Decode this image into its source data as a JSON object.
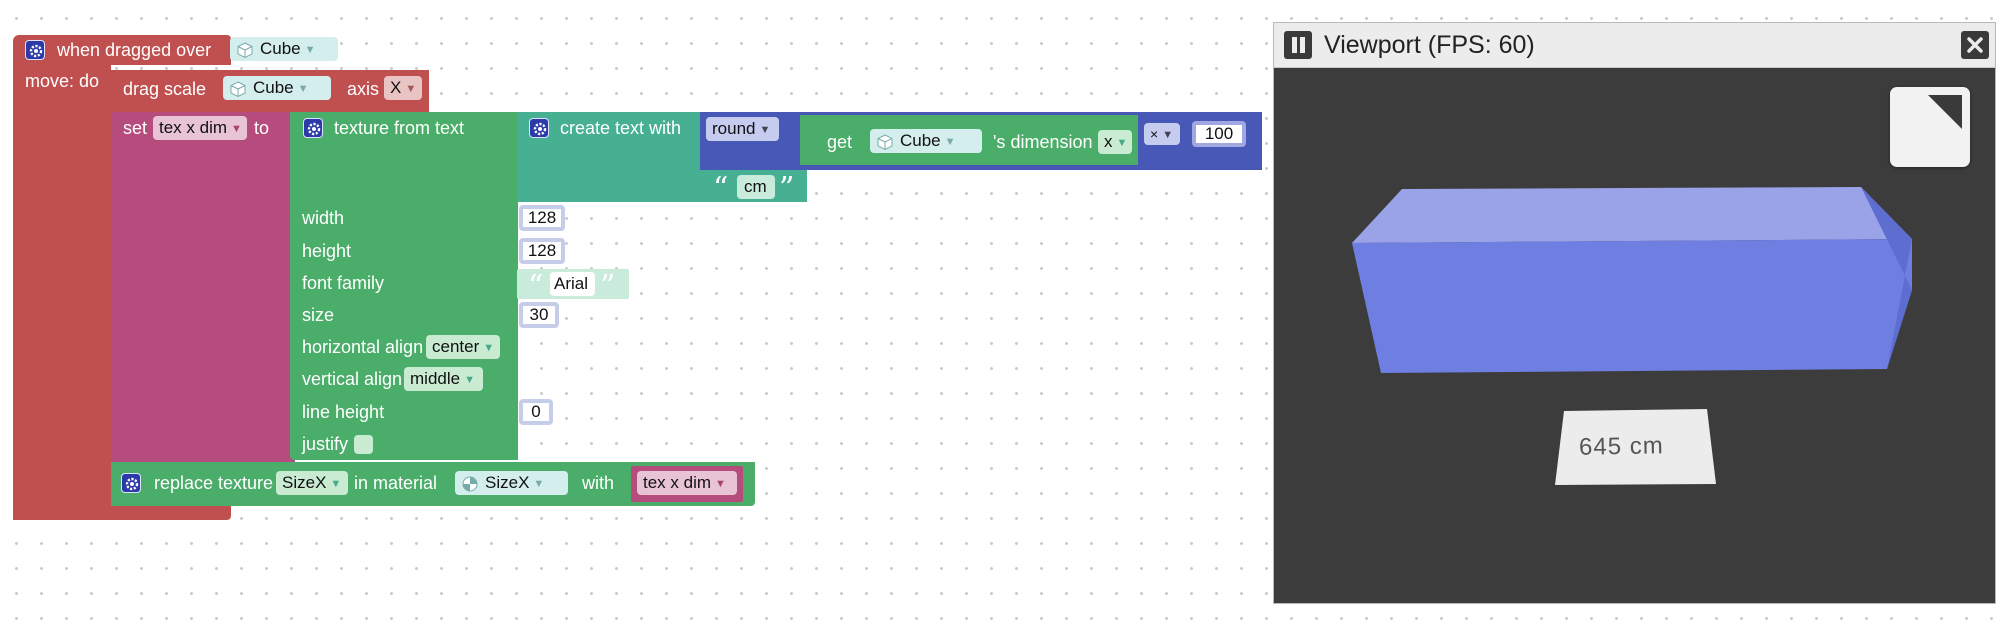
{
  "blocks": {
    "event": {
      "label": "when dragged over",
      "object": "Cube",
      "do_label": "move: do"
    },
    "drag_scale": {
      "label": "drag scale",
      "object": "Cube",
      "axis_label": "axis",
      "axis_value": "X"
    },
    "set_var": {
      "set_label": "set",
      "variable": "tex x dim",
      "to_label": "to"
    },
    "texture_from_text": {
      "label": "texture from text",
      "params": {
        "width": {
          "label": "width",
          "value": "128"
        },
        "height": {
          "label": "height",
          "value": "128"
        },
        "font_family": {
          "label": "font family",
          "value": "Arial"
        },
        "size": {
          "label": "size",
          "value": "30"
        },
        "horizontal_align": {
          "label": "horizontal align",
          "value": "center"
        },
        "vertical_align": {
          "label": "vertical align",
          "value": "middle"
        },
        "line_height": {
          "label": "line height",
          "value": "0"
        },
        "justify": {
          "label": "justify",
          "checked": false
        }
      }
    },
    "create_text": {
      "label": "create text with",
      "round_op": "round",
      "suffix_text": "cm"
    },
    "get_dimension": {
      "get_label": "get",
      "object": "Cube",
      "dimension_label": "'s dimension",
      "axis": "x",
      "operator": "×",
      "multiplier": "100"
    },
    "replace_texture": {
      "label": "replace texture",
      "texture": "SizeX",
      "material_label": "in material",
      "material": "SizeX",
      "with_label": "with",
      "variable": "tex x dim"
    }
  },
  "viewport": {
    "title": "Viewport (FPS: 60)",
    "label_text": "645 cm",
    "pause_icon": "pause-icon",
    "close_icon": "close-icon",
    "fullscreen_icon": "fullscreen-icon"
  },
  "colors": {
    "event_block": "#c0504f",
    "set_block": "#b64c7e",
    "texture_block": "#4aae6a",
    "text_block": "#48b092",
    "math_block": "#4858b6",
    "object_field": "#d4eeee",
    "cube_face": "#6f7fe1",
    "viewport_bg": "#3c3c3c"
  }
}
